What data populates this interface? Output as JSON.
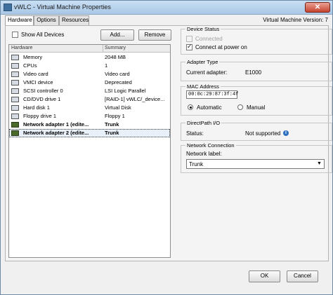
{
  "window": {
    "title": "vWLC - Virtual Machine Properties",
    "close_symbol": "✕",
    "vm_version": "Virtual Machine Version: 7"
  },
  "tabs": [
    {
      "label": "Hardware",
      "active": true
    },
    {
      "label": "Options",
      "active": false
    },
    {
      "label": "Resources",
      "active": false
    }
  ],
  "hardware": {
    "show_all_label": "Show All Devices",
    "show_all_checked": false,
    "add_label": "Add...",
    "remove_label": "Remove",
    "columns": [
      "Hardware",
      "Summary"
    ],
    "rows": [
      {
        "icon": "memory-icon",
        "name": "Memory",
        "summary": "2048 MB",
        "bold": false
      },
      {
        "icon": "cpu-icon",
        "name": "CPUs",
        "summary": "1",
        "bold": false
      },
      {
        "icon": "video-card-icon",
        "name": "Video card",
        "summary": "Video card",
        "bold": false
      },
      {
        "icon": "vmci-device-icon",
        "name": "VMCI device",
        "summary": "Deprecated",
        "bold": false
      },
      {
        "icon": "scsi-controller-icon",
        "name": "SCSI controller 0",
        "summary": "LSI Logic Parallel",
        "bold": false
      },
      {
        "icon": "cd-dvd-drive-icon",
        "name": "CD/DVD drive 1",
        "summary": "[RAID-1] vWLC/_device...",
        "bold": false
      },
      {
        "icon": "hard-disk-icon",
        "name": "Hard disk 1",
        "summary": "Virtual Disk",
        "bold": false
      },
      {
        "icon": "floppy-drive-icon",
        "name": "Floppy drive 1",
        "summary": "Floppy 1",
        "bold": false
      },
      {
        "icon": "network-adapter-icon",
        "name": "Network adapter 1 (edite...",
        "summary": "Trunk",
        "bold": true
      },
      {
        "icon": "network-adapter-icon",
        "name": "Network adapter 2 (edite...",
        "summary": "Trunk",
        "bold": true
      }
    ],
    "selected_row": 9
  },
  "device_status": {
    "title": "Device Status",
    "connected_label": "Connected",
    "connected_checked": false,
    "connect_power_label": "Connect at power on",
    "connect_power_checked": true
  },
  "adapter_type": {
    "title": "Adapter Type",
    "current_label": "Current adapter:",
    "current_value": "E1000"
  },
  "mac": {
    "title": "MAC Address",
    "value": "00:0c:29:87:3f:4f",
    "automatic_label": "Automatic",
    "manual_label": "Manual",
    "selected": "Automatic"
  },
  "directpath": {
    "title": "DirectPath I/O",
    "status_label": "Status:",
    "status_value": "Not supported",
    "info_symbol": "i"
  },
  "network_connection": {
    "title": "Network Connection",
    "label": "Network label:",
    "value": "Trunk",
    "arrow": "▼"
  },
  "footer": {
    "ok_label": "OK",
    "cancel_label": "Cancel"
  }
}
